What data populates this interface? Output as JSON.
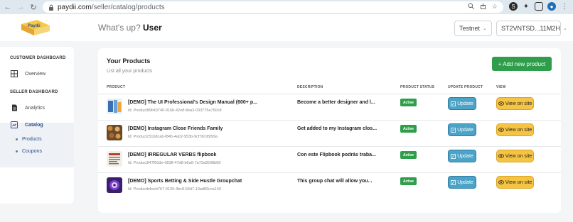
{
  "browser": {
    "url_host": "paydii.com",
    "url_path": "/seller/catalog/products",
    "profile_initial": "S"
  },
  "header": {
    "greeting_prefix": "What's up?",
    "greeting_name": "User",
    "network": "Testnet",
    "wallet": "ST2VNTSD...11M2H"
  },
  "sidebar": {
    "customer_heading": "CUSTOMER DASHBOARD",
    "overview": "Overview",
    "seller_heading": "SELLER DASHBOARD",
    "analytics": "Analytics",
    "catalog": "Catalog",
    "products": "Products",
    "coupons": "Coupons"
  },
  "main": {
    "title": "Your Products",
    "subtitle": "List all your products",
    "add_button": "+ Add new product",
    "columns": {
      "product": "PRODUCT",
      "description": "DESCRIPTION",
      "status": "PRODUCT STATUS",
      "update": "UPDATE PRODUCT",
      "view": "VIEW"
    },
    "update_label": "Update",
    "view_label": "View on site",
    "rows": [
      {
        "name": "[DEMO] The UI Professional's Design Manual (600+ p...",
        "id": "Id: Product89b43740-916b-42e8-8ea3-033775e750c8",
        "description": "Become a better designer and l...",
        "status": "Active"
      },
      {
        "name": "[DEMO] Instagram Close Friends Family",
        "id": "Id: Productc51b8cab-f845-4a02-953b-9cf78c95f99a",
        "description": "Get added to my Instagram clos...",
        "status": "Active"
      },
      {
        "name": "[DEMO] IRREGULAR VERBS flipbook",
        "id": "Id: Product947f50de-0838-47d8-b6a9-7a73a8598b68",
        "description": "Con este Flipbook podrás traba...",
        "status": "Active"
      },
      {
        "name": "[DEMO] Sports Betting & Side Hustle Groupchat",
        "id": "Id: Productb4eeb767-0139-4bc8-93d7-10ad89cca140",
        "description": "This group chat will allow you...",
        "status": "Active"
      }
    ]
  },
  "colors": {
    "primary_green": "#2e9e4b",
    "update_blue": "#4ba3c7",
    "view_yellow": "#f6c443",
    "catalog_blue": "#2b4f8a"
  }
}
